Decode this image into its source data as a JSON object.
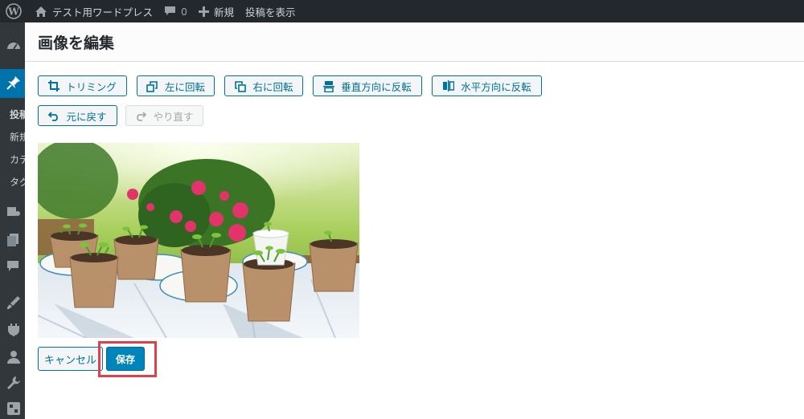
{
  "adminbar": {
    "site_name": "テスト用ワードプレス",
    "comments_count": "0",
    "new_label": "新規",
    "view_post_label": "投稿を表示"
  },
  "sidebar": {
    "partial_labels": [
      "投稿",
      "新規",
      "カテ",
      "タグ"
    ]
  },
  "modal": {
    "title": "画像を編集",
    "toolbar": {
      "crop_label": "トリミング",
      "rotate_left_label": "左に回転",
      "rotate_right_label": "右に回転",
      "flip_vertical_label": "垂直方向に反転",
      "flip_horizontal_label": "水平方向に反転",
      "undo_label": "元に戻す",
      "redo_label": "やり直す"
    },
    "cancel_label": "キャンセル",
    "save_label": "保存"
  },
  "colors": {
    "accent": "#0073aa",
    "highlight": "#e0404a"
  },
  "icons": [
    "wordpress-icon",
    "home-icon",
    "comment-icon",
    "plus-icon",
    "crop-icon",
    "rotate-left-icon",
    "rotate-right-icon",
    "flip-vertical-icon",
    "flip-horizontal-icon",
    "undo-icon",
    "redo-icon"
  ]
}
